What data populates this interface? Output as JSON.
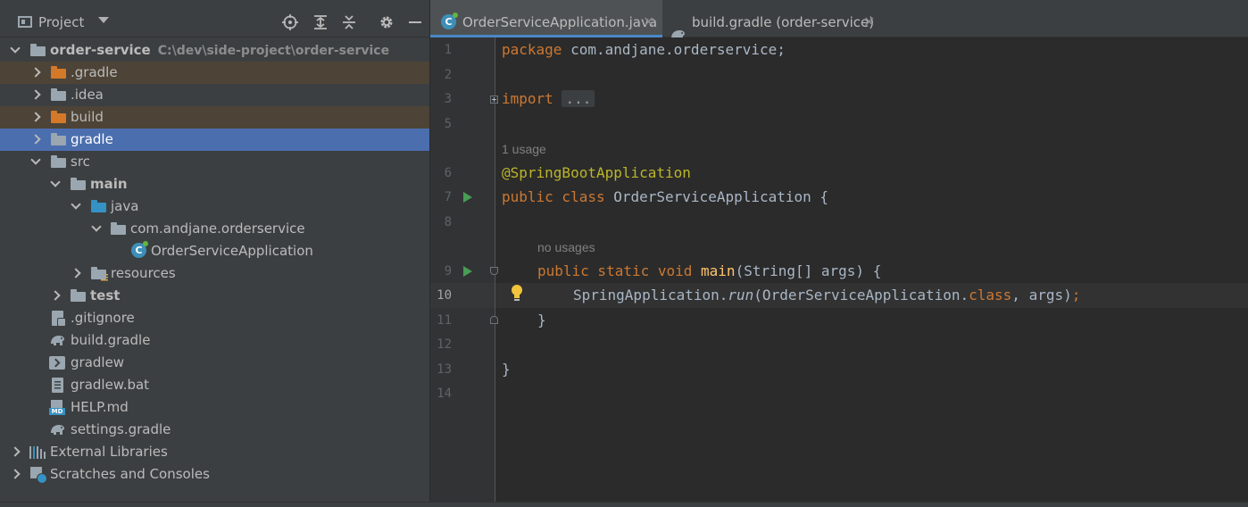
{
  "project_panel": {
    "title": "Project",
    "toolbar_icons": [
      "locate-icon",
      "expand-all-icon",
      "collapse-all-icon",
      "gear-icon",
      "hide-icon"
    ]
  },
  "tree": {
    "root": {
      "label": "order-service",
      "path": "C:\\dev\\side-project\\order-service"
    },
    "items": [
      {
        "label": ".gradle"
      },
      {
        "label": ".idea"
      },
      {
        "label": "build"
      },
      {
        "label": "gradle"
      },
      {
        "label": "src"
      },
      {
        "label": "main"
      },
      {
        "label": "java"
      },
      {
        "label": "com.andjane.orderservice"
      },
      {
        "label": "OrderServiceApplication"
      },
      {
        "label": "resources"
      },
      {
        "label": "test"
      },
      {
        "label": ".gitignore"
      },
      {
        "label": "build.gradle"
      },
      {
        "label": "gradlew"
      },
      {
        "label": "gradlew.bat"
      },
      {
        "label": "HELP.md"
      },
      {
        "label": "settings.gradle"
      },
      {
        "label": "External Libraries"
      },
      {
        "label": "Scratches and Consoles"
      }
    ],
    "md_tag": "MD"
  },
  "tabs": [
    {
      "label": "OrderServiceApplication.java",
      "active": true
    },
    {
      "label": "build.gradle (order-service)",
      "active": false
    }
  ],
  "editor": {
    "line_numbers": [
      "1",
      "2",
      "3",
      "5",
      "6",
      "7",
      "8",
      "9",
      "10",
      "11",
      "12",
      "13",
      "14"
    ],
    "current_line": "10",
    "hints": {
      "usage": "1 usage",
      "no_usages": "no usages"
    },
    "code": {
      "l1_kw": "package",
      "l1_rest": " com.andjane.orderservice;",
      "l3_kw": "import",
      "l3_fold": "...",
      "l6_ann": "@SpringBootApplication",
      "l7_kw": "public class",
      "l7_rest": " OrderServiceApplication {",
      "l9_kw": "public static void",
      "l9_fn": " main",
      "l9_rest": "(String[] args) {",
      "l10_a": "SpringApplication.",
      "l10_run": "run",
      "l10_b": "(OrderServiceApplication.",
      "l10_kw": "class",
      "l10_c": ", args)",
      "l10_semi": ";",
      "l11": "}",
      "l13": "}"
    },
    "class_icon_letter": "C"
  }
}
